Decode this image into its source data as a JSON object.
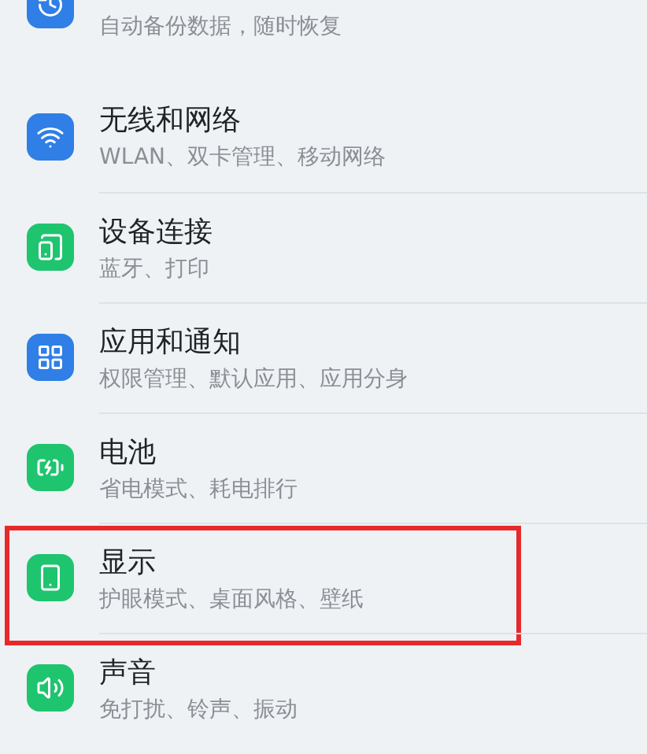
{
  "partial_item": {
    "subtitle": "自动备份数据，随时恢复",
    "color": "#2f7fe6"
  },
  "items": [
    {
      "title": "无线和网络",
      "subtitle": "WLAN、双卡管理、移动网络",
      "color": "#2f7fe6",
      "highlighted": false
    },
    {
      "title": "设备连接",
      "subtitle": "蓝牙、打印",
      "color": "#1fc46f",
      "highlighted": false
    },
    {
      "title": "应用和通知",
      "subtitle": "权限管理、默认应用、应用分身",
      "color": "#2f7fe6",
      "highlighted": false
    },
    {
      "title": "电池",
      "subtitle": "省电模式、耗电排行",
      "color": "#1fc46f",
      "highlighted": false
    },
    {
      "title": "显示",
      "subtitle": "护眼模式、桌面风格、壁纸",
      "color": "#1fc46f",
      "highlighted": true
    },
    {
      "title": "声音",
      "subtitle": "免打扰、铃声、振动",
      "color": "#1fc46f",
      "highlighted": false
    }
  ]
}
